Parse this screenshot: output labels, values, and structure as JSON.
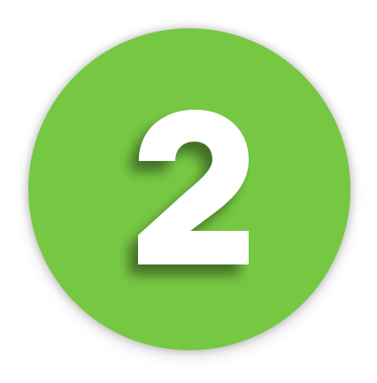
{
  "badge": {
    "number": "2",
    "circle_color": "#76c843",
    "digit_color": "#ffffff"
  }
}
